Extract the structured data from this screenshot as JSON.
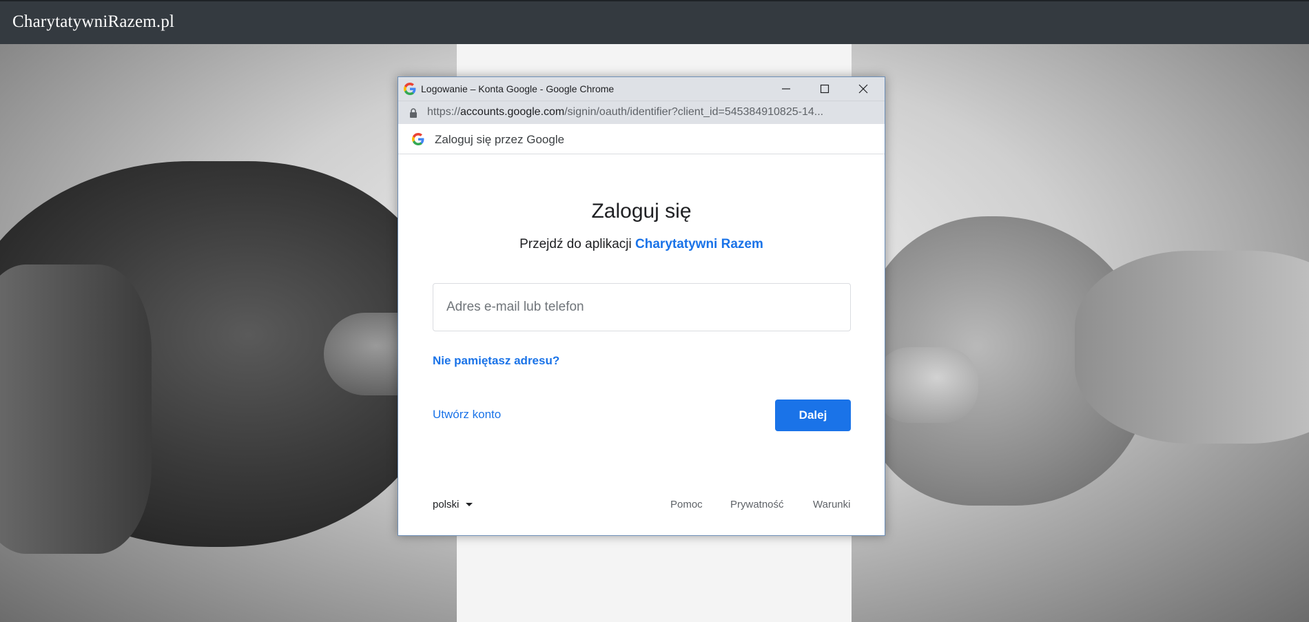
{
  "site": {
    "brand": "CharytatywniRazem.pl"
  },
  "popup_window": {
    "title": "Logowanie – Konta Google - Google Chrome",
    "url_prefix": "https://",
    "url_host": "accounts.google.com",
    "url_path": "/signin/oauth/identifier?client_id=545384910825-14...",
    "controls": {
      "minimize": "minimize-icon",
      "maximize": "maximize-icon",
      "close": "close-icon"
    }
  },
  "google_header": {
    "text": "Zaloguj się przez Google"
  },
  "signin": {
    "heading": "Zaloguj się",
    "subheading_prefix": "Przejdź do aplikacji",
    "app_name": "Charytatywni Razem",
    "email_placeholder": "Adres e-mail lub telefon",
    "email_value": "",
    "forgot_link": "Nie pamiętasz adresu?",
    "create_account": "Utwórz konto",
    "next_button": "Dalej"
  },
  "footer": {
    "language": "polski",
    "links": [
      "Pomoc",
      "Prywatność",
      "Warunki"
    ]
  },
  "colors": {
    "navbar": "#343a40",
    "google_blue": "#1a73e8",
    "chrome_titlebar": "#dee1e6"
  }
}
